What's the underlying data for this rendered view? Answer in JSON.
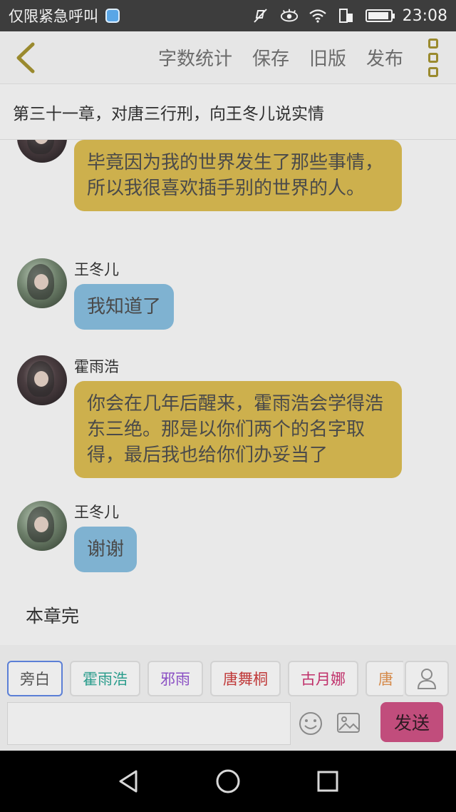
{
  "status_bar": {
    "carrier_text": "仅限紧急呼叫",
    "time": "23:08",
    "battery_level": 0.95
  },
  "toolbar": {
    "back_icon": "chevron-left-icon",
    "actions": [
      "字数统计",
      "保存",
      "旧版",
      "发布"
    ],
    "more_icon": "more-vertical-icon"
  },
  "chapter": {
    "title": "第三十一章，对唐三行刑，向王冬儿说实情"
  },
  "messages": [
    {
      "sender": "",
      "text": "毕竟因为我的世界发生了那些事情，所以我很喜欢插手别的世界的人。",
      "color": "#cdb04d"
    },
    {
      "sender": "王冬儿",
      "text": "我知道了",
      "color": "#7fb2d1"
    },
    {
      "sender": "霍雨浩",
      "text": "你会在几年后醒来，霍雨浩会学得浩东三绝。那是以你们两个的名字取得，最后我也给你们办妥当了",
      "color": "#cdb04d"
    },
    {
      "sender": "王冬儿",
      "text": "谢谢",
      "color": "#7fb2d1"
    }
  ],
  "end_text": "本章完",
  "roles": [
    {
      "label": "旁白",
      "color": "#555555"
    },
    {
      "label": "霍雨浩",
      "color": "#2a9c8c"
    },
    {
      "label": "邪雨",
      "color": "#8a4fc4"
    },
    {
      "label": "唐舞桐",
      "color": "#c03a3a"
    },
    {
      "label": "古月娜",
      "color": "#c0306a"
    },
    {
      "label": "唐",
      "color": "#d58a4a"
    }
  ],
  "input": {
    "placeholder": "",
    "send_label": "发送"
  },
  "colors": {
    "accent": "#c14d7c",
    "yellow_bubble": "#cdb04d",
    "blue_bubble": "#7fb2d1"
  }
}
